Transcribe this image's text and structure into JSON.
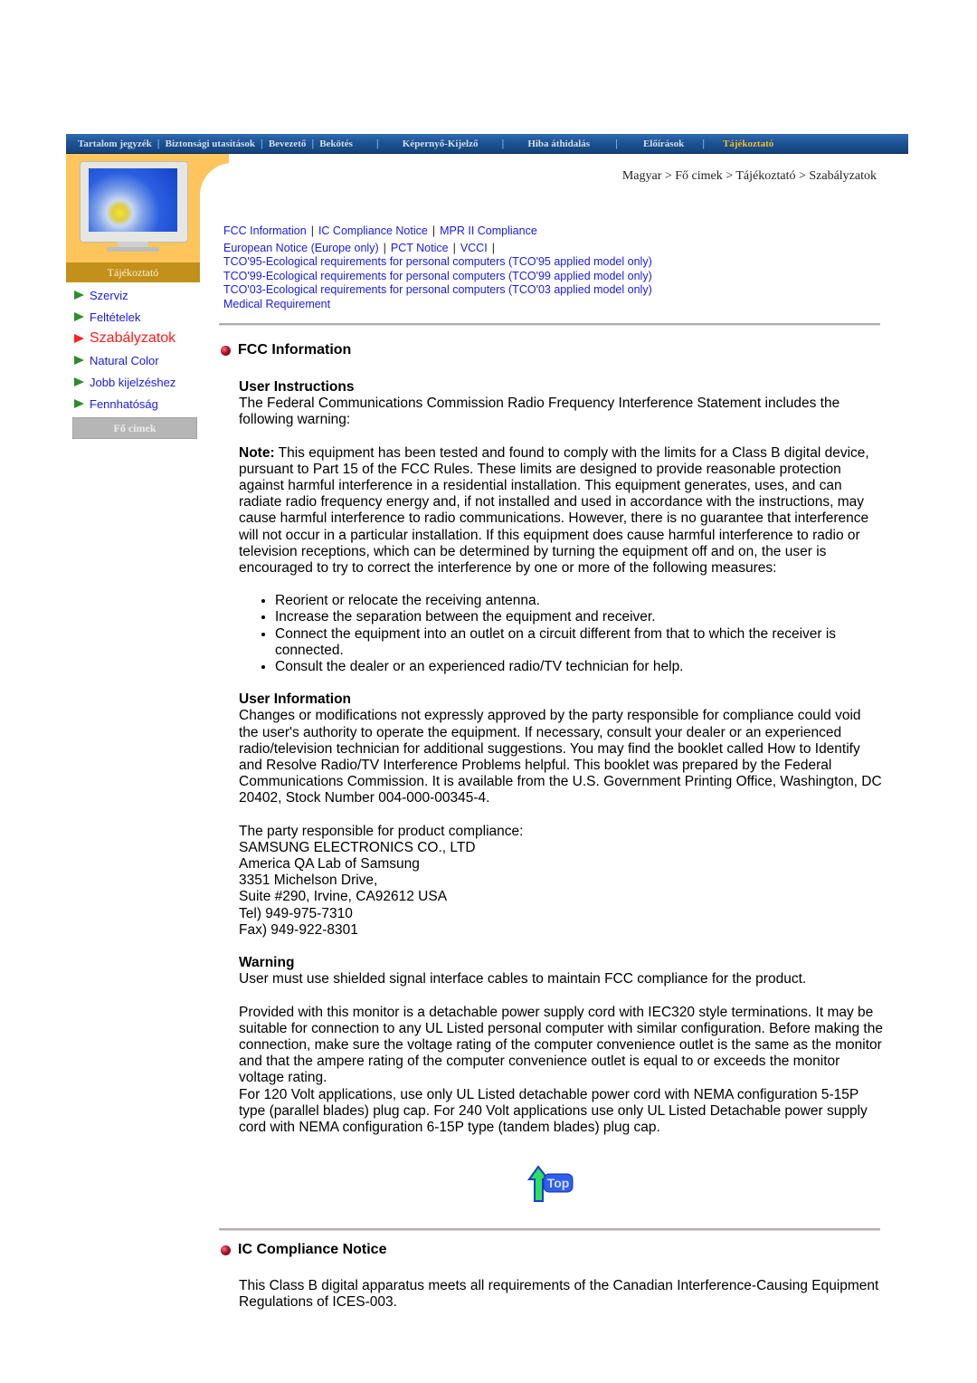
{
  "nav": {
    "items": [
      {
        "label": "Tartalom jegyzék",
        "active": false
      },
      {
        "label": "Biztonsági utasítások",
        "active": false
      },
      {
        "label": "Bevezető",
        "active": false
      },
      {
        "label": "Bekötés",
        "active": false
      },
      {
        "label": "Képernyő-Kijelző",
        "active": false
      },
      {
        "label": "Hiba áthidalás",
        "active": false
      },
      {
        "label": "Előírások",
        "active": false
      },
      {
        "label": "Tájékoztató",
        "active": true
      }
    ]
  },
  "left_panel": {
    "image_icon": "monitor-image",
    "title": "Tájékoztató"
  },
  "sidebar": {
    "items": [
      {
        "label": "Szerviz",
        "active": false
      },
      {
        "label": "Feltételek",
        "active": false
      },
      {
        "label": "Szabályzatok",
        "active": true
      },
      {
        "label": "Natural Color",
        "active": false
      },
      {
        "label": "Jobb kijelzéshez",
        "active": false
      },
      {
        "label": "Fennhatóság",
        "active": false
      }
    ],
    "home_button": "Fő cimek"
  },
  "breadcrumb": "Magyar > Fő cimek > Tájékoztató > Szabályzatok",
  "links": {
    "row1": [
      "FCC Information",
      "IC Compliance Notice",
      "MPR II Compliance"
    ],
    "row2": [
      "European Notice (Europe only)",
      "PCT Notice",
      "VCCI"
    ],
    "tco95": "TCO'95-Ecological requirements for personal computers (TCO'95 applied model only)",
    "tco99": "TCO'99-Ecological requirements for personal computers (TCO'99 applied model only)",
    "tco03": "TCO'03-Ecological requirements for personal computers (TCO'03 applied model only)",
    "medical": "Medical Requirement"
  },
  "fcc": {
    "heading": "FCC Information",
    "user_instructions_title": "User Instructions",
    "user_instructions_text": "The Federal Communications Commission Radio Frequency Interference Statement includes the following warning:",
    "note_label": "Note:",
    "note_text": " This equipment has been tested and found to comply with the limits for a Class B digital device, pursuant to Part 15 of the FCC Rules. These limits are designed to provide reasonable protection against harmful interference in a residential installation. This equipment generates, uses, and can radiate radio frequency energy and, if not installed and used in accordance with the instructions, may cause harmful interference to radio communications. However, there is no guarantee that interference will not occur in a particular installation. If this equipment does cause harmful interference to radio or television receptions, which can be determined by turning the equipment off and on, the user is encouraged to try to correct the interference by one or more of the following measures:",
    "measures": [
      "Reorient or relocate the receiving antenna.",
      "Increase the separation between the equipment and receiver.",
      "Connect the equipment into an outlet on a circuit different from that to which the receiver is connected.",
      "Consult the dealer or an experienced radio/TV technician for help."
    ],
    "user_information_title": "User Information",
    "user_information_text": "Changes or modifications not expressly approved by the party responsible for compliance could void the user's authority to operate the equipment. If necessary, consult your dealer or an experienced radio/television technician for additional suggestions. You may find the booklet called How to Identify and Resolve Radio/TV Interference Problems helpful. This booklet was prepared by the Federal Communications Commission. It is available from the U.S. Government Printing Office, Washington, DC 20402, Stock Number 004-000-00345-4.",
    "responsible_party": [
      "The party responsible for product compliance:",
      "SAMSUNG ELECTRONICS CO., LTD",
      "America QA Lab of Samsung",
      "3351 Michelson Drive,",
      "Suite #290, Irvine, CA92612 USA",
      "Tel) 949-975-7310",
      "Fax) 949-922-8301"
    ],
    "warning_title": "Warning",
    "warning_text": "User must use shielded signal interface cables to maintain FCC compliance for the product.",
    "power_text_1": "Provided with this monitor is a detachable power supply cord with IEC320 style terminations. It may be suitable for connection to any UL Listed personal computer with similar configuration. Before making the connection, make sure the voltage rating of the computer convenience outlet is the same as the monitor and that the ampere rating of the computer convenience outlet is equal to or exceeds the monitor voltage rating.",
    "power_text_2": "For 120 Volt applications, use only UL Listed detachable power cord with NEMA configuration 5-15P type (parallel blades) plug cap. For 240 Volt applications use only UL Listed Detachable power supply cord with NEMA configuration 6-15P type (tandem blades) plug cap."
  },
  "top_button": {
    "label": "Top",
    "icon": "up-arrow-top-icon"
  },
  "ic": {
    "heading": "IC Compliance Notice",
    "text": "This Class B digital apparatus meets all requirements of the Canadian Interference-Causing Equipment Regulations of ICES-003."
  }
}
